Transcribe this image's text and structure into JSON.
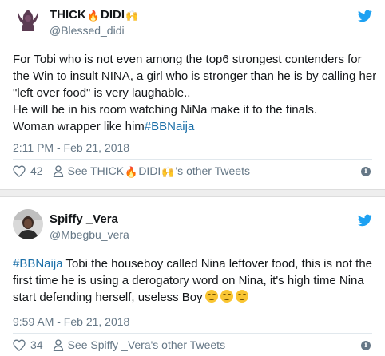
{
  "colors": {
    "twitter_blue": "#1da1f2",
    "hashtag": "#1b6fa8",
    "meta_gray": "#657786",
    "text": "#14171a",
    "divider": "#eeeeee",
    "smiley_yellow": "#f9c532"
  },
  "tweets": [
    {
      "user": {
        "name_prefix": "THICK",
        "name_suffix": "DIDI",
        "name_emojis": [
          "fire-emoji",
          "raised-hands-emoji"
        ],
        "handle": "@Blessed_didi",
        "avatar_icon": "profile-avatar-silhouette-icon"
      },
      "body": {
        "line1": "For Tobi who is not even among the top6 strongest contenders for the Win to insult NINA, a girl who is stronger than he is by calling her \"left over food\" is very laughable..",
        "line2": "He will be in his room watching NiNa make it to the finals.",
        "line3_text": "Woman wrapper like him",
        "line3_hashtag": "#BBNaija"
      },
      "timestamp": "2:11 PM - Feb 21, 2018",
      "likes": "42",
      "profile_link_prefix": "See THICK",
      "profile_link_mid": "DIDI",
      "profile_link_suffix": "'s other Tweets"
    },
    {
      "user": {
        "name": "Spiffy _Vera",
        "handle": "@Mbegbu_vera",
        "avatar_icon": "profile-photo-icon"
      },
      "body": {
        "hashtag": "#BBNaija",
        "text": " Tobi the houseboy called Nina leftover food, this is not the first time he is using a derogatory word on Nina, it's high time Nina start defending herself, useless Boy",
        "trailing_emojis": [
          "smirking-face-emoji",
          "smirking-face-emoji",
          "smirking-face-emoji"
        ]
      },
      "timestamp": "9:59 AM - Feb 21, 2018",
      "likes": "34",
      "profile_link": "See Spiffy _Vera's other Tweets"
    }
  ]
}
